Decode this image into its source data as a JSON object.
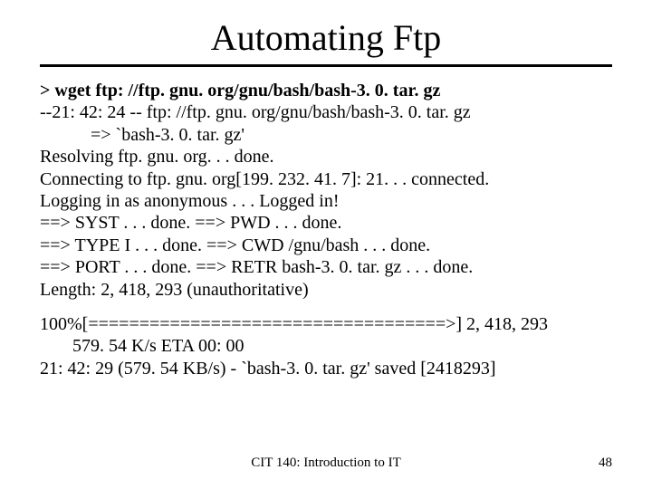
{
  "title": "Automating Ftp",
  "lines": {
    "cmd": "> wget ftp: //ftp. gnu. org/gnu/bash/bash-3. 0. tar. gz",
    "l1": "--21: 42: 24 --  ftp: //ftp. gnu. org/gnu/bash/bash-3. 0. tar. gz",
    "l2": "=> `bash-3. 0. tar. gz'",
    "l3": "Resolving ftp. gnu. org. . . done.",
    "l4": "Connecting to ftp. gnu. org[199. 232. 41. 7]: 21. . . connected.",
    "l5": "Logging in as anonymous . . . Logged in!",
    "l6": "==> SYST . . . done.    ==> PWD . . . done.",
    "l7": "==> TYPE I . . . done.  ==> CWD /gnu/bash . . . done.",
    "l8": "==> PORT . . . done.    ==> RETR bash-3. 0. tar. gz . . . done.",
    "l9": "Length: 2, 418, 293 (unauthoritative)",
    "prog1": "100%[===================================>] 2, 418, 293",
    "prog2": "579. 54 K/s    ETA 00: 00",
    "final": "21: 42: 29 (579. 54 KB/s) - `bash-3. 0. tar. gz' saved [2418293]"
  },
  "footer": {
    "center": "CIT 140: Introduction to IT",
    "page": "48"
  }
}
